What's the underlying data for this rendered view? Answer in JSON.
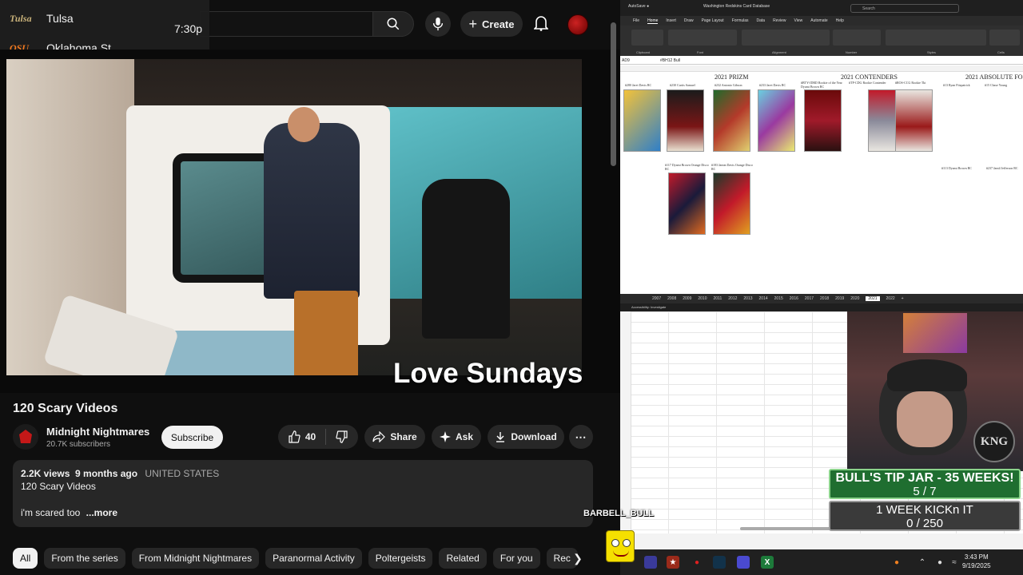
{
  "scoreboard": {
    "team1": {
      "logo": "Tulsa",
      "name": "Tulsa"
    },
    "team2": {
      "logo": "OSU",
      "name": "Oklahoma St"
    },
    "time": "7:30p"
  },
  "header": {
    "create_label": "Create"
  },
  "video": {
    "caption": "Love Sundays",
    "title": "120 Scary Videos"
  },
  "channel": {
    "name": "Midnight Nightmares",
    "subscribers": "20.7K subscribers",
    "subscribe_label": "Subscribe"
  },
  "actions": {
    "likes": "40",
    "share": "Share",
    "ask": "Ask",
    "download": "Download"
  },
  "description": {
    "views": "2.2K views",
    "age": "9 months ago",
    "country": "UNITED STATES",
    "line2": "120 Scary Videos",
    "line3": "i'm scared too",
    "more": "...more"
  },
  "chips": [
    "All",
    "From the series",
    "From Midnight Nightmares",
    "Paranormal Activity",
    "Poltergeists",
    "Related",
    "For you",
    "Rec"
  ],
  "excel": {
    "title": "Washington Redskins Card Database",
    "search": "Search",
    "tabs": [
      "File",
      "Home",
      "Insert",
      "Draw",
      "Page Layout",
      "Formulas",
      "Data",
      "Review",
      "View",
      "Automate",
      "Help"
    ],
    "formula_cell": "AD9",
    "formula": "#BH12 Bull",
    "groups": [
      "Clipboard",
      "Font",
      "Alignment",
      "Number",
      "Styles",
      "Cells"
    ],
    "sections": [
      "2021 PRIZM",
      "2021 CONTENDERS",
      "2021 ABSOLUTE FO"
    ],
    "card_labels_row1": [
      "#280 Jaret Davis RC",
      "#230 Curtis Samuel",
      "#232 Antonio Gibson",
      "#233 Jaret Davis RC",
      "#BTY-JDRD Rookie of the Year Dyami Brown RC",
      "#TP-CDG Rookie Contender",
      "#ROS-CCG Rookie Tkt",
      "#13 Ryan Fitzpatrick",
      "#15 Chase Young"
    ],
    "card_labels_row2": [
      "#117 Dyami Brown Orange Disco RC",
      "#183 Jamin Davis Orange Disco RC",
      "#113 Dyami Brown RC",
      "#237 Jamil Jefferson RC"
    ],
    "sheet_tabs": [
      "2007",
      "2008",
      "2009",
      "2010",
      "2011",
      "2012",
      "2013",
      "2014",
      "2015",
      "2016",
      "2017",
      "2018",
      "2019",
      "2020",
      "2021",
      "2022",
      "+"
    ],
    "active_sheet": "2021",
    "status": "Accessibility: Investigate"
  },
  "overlays": {
    "tip_jar_title": "BULL'S TIP JAR - 35 WEEKS!",
    "tip_jar_count": "5 / 7",
    "goal_title": "1 WEEK KICKn IT",
    "goal_count": "0 / 250",
    "alert_name": "BARBELL_BULL",
    "king_badge": "KNG"
  },
  "taskbar": {
    "time": "3:43 PM",
    "date": "9/19/2025"
  }
}
